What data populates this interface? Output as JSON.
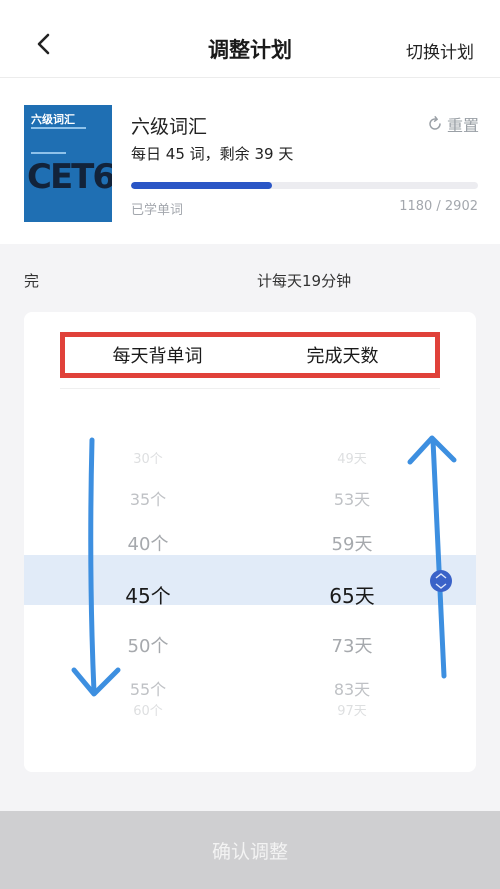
{
  "header": {
    "back_icon": "chevron-left-icon",
    "title": "调整计划",
    "switch_label": "切换计划"
  },
  "book": {
    "name": "六级词汇",
    "daily_prefix": "每日",
    "daily_words": "45",
    "daily_mid": "词，剩余",
    "days_left": "39",
    "daily_suffix": "天",
    "reset_label": "重置",
    "reset_icon": "refresh-icon",
    "cover_title": "六级词汇",
    "cover_mark": "CET6",
    "learned_label": "已学单词",
    "learned_count": "1180 / 2902",
    "progress": 0.4066
  },
  "summary": {
    "left": "完",
    "right": "计每天19分钟"
  },
  "picker": {
    "col_words": "每天背单词",
    "col_days": "完成天数",
    "words": [
      "30个",
      "35个",
      "40个",
      "45个",
      "50个",
      "55个",
      "60个"
    ],
    "days": [
      "49天",
      "53天",
      "59天",
      "65天",
      "73天",
      "83天",
      "97天"
    ],
    "selected_index": 3
  },
  "confirm_label": "确认调整",
  "colors": {
    "accent": "#2a56c6",
    "highlight": "#e1ebf8",
    "annotation_red": "#e0413a",
    "annotation_blue": "#3d8fe0"
  }
}
